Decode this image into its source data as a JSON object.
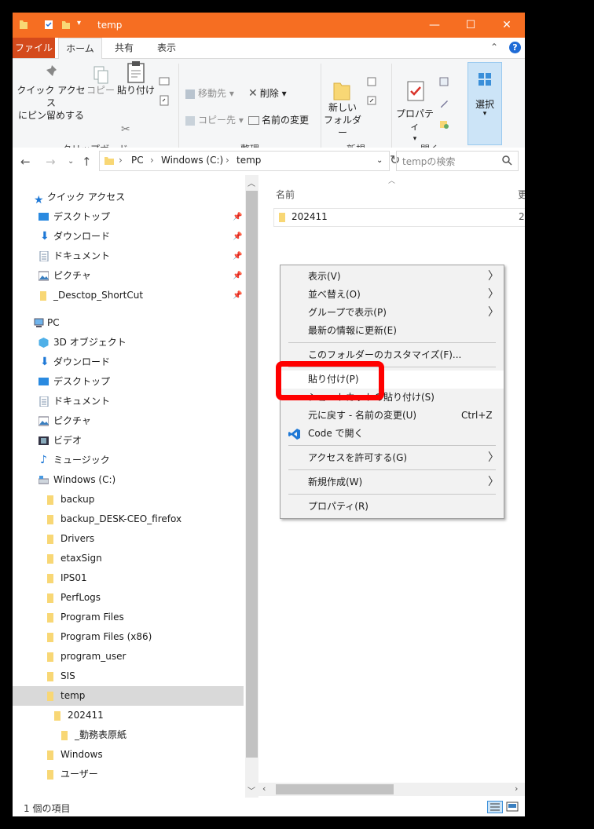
{
  "window": {
    "title": "temp",
    "accent": "#f66e22",
    "controls": {
      "minimize": "—",
      "maximize": "☐",
      "close": "✕"
    }
  },
  "ribbon_tabs": [
    "ファイル",
    "ホーム",
    "共有",
    "表示"
  ],
  "ribbon": {
    "clipboard": {
      "label": "クリップボード",
      "pin_quick_line1": "クイック アクセス",
      "pin_quick_line2": "にピン留めする",
      "copy": "コピー",
      "paste": "貼り付け"
    },
    "organize": {
      "label": "整理",
      "move_to": "移動先",
      "copy_to": "コピー先",
      "delete": "削除",
      "rename": "名前の変更"
    },
    "new": {
      "label": "新規",
      "new_folder_line1": "新しい",
      "new_folder_line2": "フォルダー"
    },
    "open": {
      "label": "開く",
      "properties": "プロパティ"
    },
    "select": {
      "label": "選択"
    }
  },
  "address": {
    "crumbs": [
      "PC",
      "Windows (C:)",
      "temp"
    ],
    "search_placeholder": "tempの検索"
  },
  "nav": {
    "quick_access": "クイック アクセス",
    "qa_items": [
      "デスクトップ",
      "ダウンロード",
      "ドキュメント",
      "ピクチャ",
      "_Desctop_ShortCut"
    ],
    "pc": "PC",
    "pc_items": [
      "3D オブジェクト",
      "ダウンロード",
      "デスクトップ",
      "ドキュメント",
      "ピクチャ",
      "ビデオ",
      "ミュージック",
      "Windows (C:)"
    ],
    "drive_folders": [
      "backup",
      "backup_DESK-CEO_firefox",
      "Drivers",
      "etaxSign",
      "IPS01",
      "PerfLogs",
      "Program Files",
      "Program Files (x86)",
      "program_user",
      "SIS",
      "temp"
    ],
    "temp_child": "202411",
    "temp_grandchild": "_勤務表原紙",
    "after_temp": [
      "Windows",
      "ユーザー"
    ]
  },
  "content": {
    "column_name": "名前",
    "column_partial": "更",
    "file_name": "202411",
    "file_partial": "2"
  },
  "context_menu": {
    "items": [
      {
        "label": "表示(V)",
        "arrow": "〉"
      },
      {
        "label": "並べ替え(O)",
        "arrow": "〉"
      },
      {
        "label": "グループで表示(P)",
        "arrow": "〉"
      },
      {
        "label": "最新の情報に更新(E)"
      },
      {
        "label": "このフォルダーのカスタマイズ(F)..."
      },
      {
        "label": "貼り付け(P)"
      },
      {
        "label": "ショートカットの貼り付け(S)"
      },
      {
        "label": "元に戻す - 名前の変更(U)",
        "shortcut": "Ctrl+Z"
      },
      {
        "label": "Code で開く"
      },
      {
        "label": "アクセスを許可する(G)",
        "arrow": "〉"
      },
      {
        "label": "新規作成(W)",
        "arrow": "〉"
      },
      {
        "label": "プロパティ(R)"
      }
    ]
  },
  "status": {
    "item_count": "1 個の項目"
  }
}
